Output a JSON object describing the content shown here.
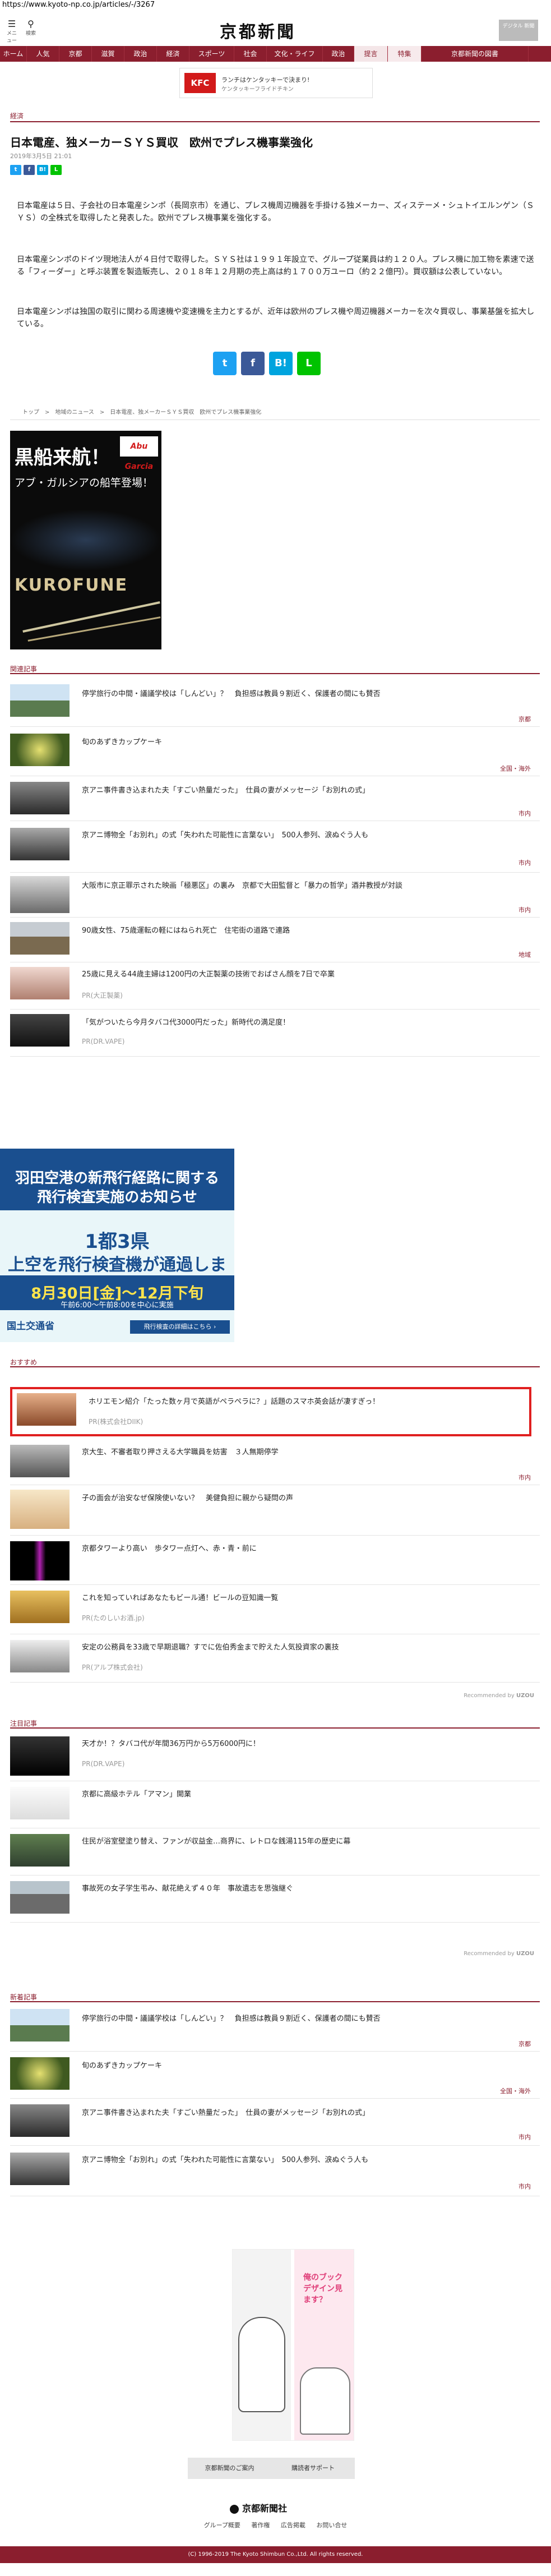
{
  "browser": {
    "url": "https://www.kyoto-np.co.jp/articles/-/3267"
  },
  "header": {
    "menu_icon": "hamburger-icon",
    "menu_label": "メニュー",
    "search_icon": "search-icon",
    "search_label": "検索",
    "logo": "京都新聞",
    "premium_label": "デジタル\n新聞"
  },
  "nav": {
    "items": [
      "ホーム",
      "人気",
      "京都",
      "滋賀",
      "政治",
      "経済",
      "スポーツ",
      "社会",
      "文化・ライフ",
      "政治",
      "提言",
      "特集",
      "京都新聞の図書"
    ]
  },
  "top_ad": {
    "brand": "KFC",
    "line1": "ランチはケンタッキーで決まり!",
    "line2": "ケンタッキーフライドチキン"
  },
  "article": {
    "section": "経済",
    "title": "日本電産、独メーカーＳＹＳ買収　欧州でプレス機事業強化",
    "date": "2019年3月5日 21:01",
    "paragraphs": [
      "日本電産は５日、子会社の日本電産シンポ（長岡京市）を通じ、プレス機周辺機器を手掛ける独メーカー、ズィステーメ・シュトイエルンゲン（ＳＹＳ）の全株式を取得したと発表した。欧州でプレス機事業を強化する。",
      "日本電産シンポのドイツ現地法人が４日付で取得した。ＳＹＳ社は１９９１年設立で、グループ従業員は約１２０人。プレス機に加工物を素速で送る「フィーダー」と呼ぶ装置を製造販売し、２０１８年１２月期の売上高は約１７００万ユーロ（約２２億円）。買収額は公表していない。",
      "日本電産シンポは独国の取引に関わる周速機や変速機を主力とするが、近年は欧州のプレス機や周辺機器メーカーを次々買収し、事業基盤を拡大している。"
    ],
    "share": [
      "twitter-icon",
      "facebook-icon",
      "hatena-icon",
      "line-icon"
    ]
  },
  "breadcrumb": "トップ　>　地域のニュース　>　日本電産、独メーカーＳＹＳ買収　欧州でプレス機事業強化",
  "side_ad": {
    "line1": "黒船来航！",
    "line2": "アブ・ガルシアの船竿登場！",
    "brand": "Abu Garcia",
    "product": "KUROFUNE"
  },
  "related": {
    "heading": "関連記事",
    "items": [
      {
        "title": "停学旅行の中間・議議学校は「しんどい」？　負担感は教員９割近く、保護者の間にも賛否",
        "cat": "京都"
      },
      {
        "title": "旬のあずきカップケーキ",
        "cat": "全国・海外"
      },
      {
        "title": "京アニ事件書き込まれた夫「すごい熱量だった」　仕員の妻がメッセージ「お別れの式」",
        "cat": "市内"
      },
      {
        "title": "京アニ博物全「お別れ」の式「失われた可能性に言葉ない」　500人参列、涙ぬぐう人も",
        "cat": "市内"
      },
      {
        "title": "大阪市に京正罪示された映画「極悪区」の裏み　京都で大田監督と「暴力の哲学」酒井教授が対談",
        "cat": "市内"
      },
      {
        "title": "90歳女性、75歳運転の軽にはねられ死亡　住宅街の道路で連路",
        "cat": "地域"
      },
      {
        "title": "25歳に見える44歳主婦は1200円の大正製薬の技術でおばさん顔を7日で卒業",
        "pr": "PR(大正製薬)"
      },
      {
        "title": "「気がついたら今月タバコ代3000円だった」新時代の満足度！",
        "pr": "PR(DR.VAPE)"
      }
    ]
  },
  "gov_ad": {
    "line1": "羽田空港の新飛行経路に関する",
    "line2": "飛行検査実施のお知らせ",
    "line3": "1都3県",
    "line4": "上空を飛行検査機が通過します",
    "line5": "8月30日[金]〜12月下旬",
    "line6": "午前6:00〜午前8:00を中心に実施",
    "org": "国土交通省",
    "cta": "飛行検査の詳細はこちら ›"
  },
  "recommended": {
    "heading": "おすすめ",
    "items": [
      {
        "title": "ホリエモン紹介「たった数ヶ月で英語がペラペラに？」話題のスマホ英会話が凄すぎっ！",
        "pr": "PR(株式会社DIIK)"
      },
      {
        "title": "京大生、不審者取り押さえる大学職員を妨害　３人無期停学",
        "cat": "市内"
      },
      {
        "title": "子の面会が治安なぜ保険使いない？　美健負担に親から疑問の声"
      },
      {
        "title": "京都タワーより高い　歩タワー点灯へ、赤・青・前に"
      },
      {
        "title": "これを知っていればあなたもビール通！ビールの豆知識一覧",
        "pr": "PR(たのしいお酒.jp)"
      },
      {
        "title": "安定の公務員を33歳で早期退職？すでに佐伯秀金まで貯えた人気投資家の裏技",
        "pr": "PR(アルプ株式会社)"
      }
    ],
    "by": "Recommended by"
  },
  "noticed": {
    "heading": "注目記事",
    "items": [
      {
        "title": "天才か！？タバコ代が年間36万円から5万6000円に！",
        "pr": "PR(DR.VAPE)"
      },
      {
        "title": "京都に高級ホテル「アマン」開業"
      },
      {
        "title": "住民が浴室壁塗り替え、ファンが収益金…商界に、レトロな銭湯115年の歴史に幕"
      },
      {
        "title": "事故死の女子学生弔み、献花絶えず４０年　事故遺志を思強継ぐ"
      }
    ],
    "by": "Recommended by"
  },
  "latest": {
    "heading": "新着記事",
    "items": [
      {
        "title": "停学旅行の中間・議議学校は「しんどい」？　負担感は教員９割近く、保護者の間にも賛否",
        "cat": "京都"
      },
      {
        "title": "旬のあずきカップケーキ",
        "cat": "全国・海外"
      },
      {
        "title": "京アニ事件書き込まれた夫「すごい熱量だった」　仕員の妻がメッセージ「お別れの式」",
        "cat": "市内"
      },
      {
        "title": "京アニ博物全「お別れ」の式「失われた可能性に言葉ない」　500人参列、涙ぬぐう人も",
        "cat": "市内"
      }
    ]
  },
  "manga_ad": {
    "title": "俺のブックデザイン見ます？"
  },
  "footer": {
    "btn1": "京都新聞のご案内",
    "btn2": "購読者サポート",
    "logo": "京都新聞社",
    "links": [
      "グループ概要",
      "著作権",
      "広告掲載",
      "お問い合せ"
    ],
    "copyright": "(C) 1996-2019 The Kyoto Shimbun Co.,Ltd. All rights reserved."
  }
}
